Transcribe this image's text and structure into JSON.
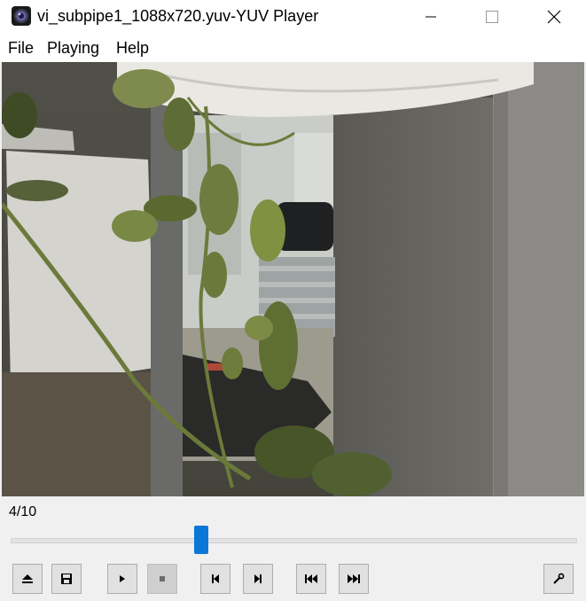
{
  "window": {
    "title": "vi_subpipe1_1088x720.yuv-YUV Player",
    "icon": "camera-lens-icon",
    "controls": [
      "minimize-icon",
      "maximize-icon",
      "close-icon"
    ]
  },
  "menu": {
    "items": [
      {
        "label": "File"
      },
      {
        "label": "Playing"
      },
      {
        "label": "Help"
      }
    ]
  },
  "player": {
    "frame_counter": "4/10",
    "current_frame": 4,
    "total_frames": 10,
    "accent_color": "#0a78d6"
  },
  "controls": [
    {
      "name": "open-button",
      "icon": "eject-icon"
    },
    {
      "name": "save-button",
      "icon": "save-icon"
    },
    {
      "name": "play-button",
      "icon": "play-icon"
    },
    {
      "name": "stop-button",
      "icon": "stop-icon",
      "disabled": true
    },
    {
      "name": "previous-frame-button",
      "icon": "step-back-icon"
    },
    {
      "name": "next-frame-button",
      "icon": "step-forward-icon"
    },
    {
      "name": "first-frame-button",
      "icon": "skip-back-icon"
    },
    {
      "name": "last-frame-button",
      "icon": "skip-forward-icon"
    },
    {
      "name": "settings-button",
      "icon": "wrench-icon"
    }
  ]
}
